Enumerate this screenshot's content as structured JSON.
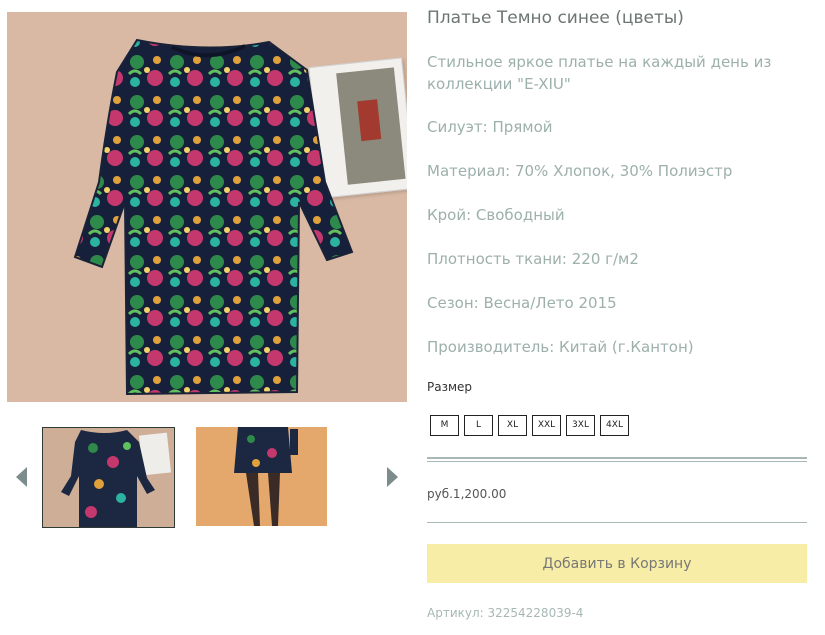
{
  "product": {
    "title": "Платье Темно синее (цветы)",
    "description": "Стильное яркое платье на каждый день из коллекции \"E-XIU\"",
    "specs": [
      "Силуэт: Прямой",
      "Материал: 70% Хлопок, 30% Полиэстр",
      "Крой: Свободный",
      "Плотность ткани: 220 г/м2",
      "Сезон: Весна/Лето 2015",
      "Производитель: Китай (г.Кантон)"
    ],
    "size_label": "Размер",
    "sizes": [
      "M",
      "L",
      "XL",
      "XXL",
      "3XL",
      "4XL"
    ],
    "price": "руб.1,200.00",
    "add_to_cart": "Добавить в Корзину",
    "sku": "Артикул: 32254228039-4"
  },
  "gallery": {
    "main_image": "floral-dark-blue-dress-photo",
    "thumbnails": [
      "dress-front-thumbnail",
      "model-wearing-dress-thumbnail"
    ],
    "prev_icon": "triangle-left-icon",
    "next_icon": "triangle-right-icon"
  },
  "colors": {
    "title": "#6b7573",
    "text_muted": "#9db0ab",
    "cart_button": "#f8eda6",
    "divider": "#a9b8b4"
  }
}
